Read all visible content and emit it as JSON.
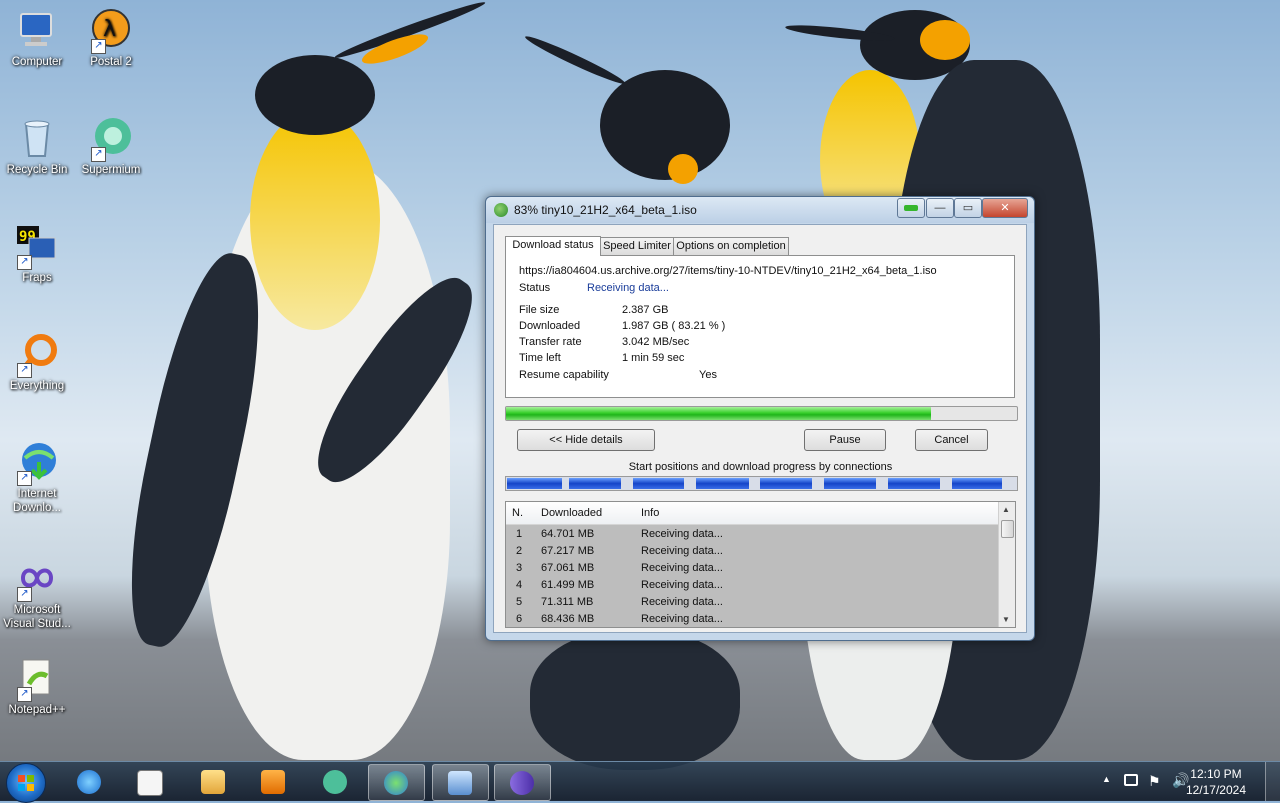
{
  "desktop": {
    "icons": [
      {
        "label": "Computer"
      },
      {
        "label": "Postal 2"
      },
      {
        "label": "Recycle Bin"
      },
      {
        "label": "Supermium"
      },
      {
        "label": "Fraps"
      },
      {
        "label": "Everything"
      },
      {
        "label": "Internet Downlo..."
      },
      {
        "label": "Microsoft Visual Stud..."
      },
      {
        "label": "Notepad++"
      }
    ]
  },
  "window": {
    "title": "83% tiny10_21H2_x64_beta_1.iso",
    "controls": {
      "minimize": "—",
      "restore": "▭",
      "close": "✕"
    },
    "tabs": [
      {
        "label": "Download status",
        "active": true
      },
      {
        "label": "Speed Limiter"
      },
      {
        "label": "Options on completion"
      }
    ],
    "status": {
      "url": "https://ia804604.us.archive.org/27/items/tiny-10-NTDEV/tiny10_21H2_x64_beta_1.iso",
      "status_label": "Status",
      "status_value": "Receiving data...",
      "file_size_label": "File size",
      "file_size_value": "2.387  GB",
      "downloaded_label": "Downloaded",
      "downloaded_value": "1.987  GB  ( 83.21 % )",
      "transfer_rate_label": "Transfer rate",
      "transfer_rate_value": "3.042  MB/sec",
      "time_left_label": "Time left",
      "time_left_value": "1 min 59 sec",
      "resume_label": "Resume capability",
      "resume_value": "Yes"
    },
    "progress_percent": 83.21,
    "buttons": {
      "hide_details": "<< Hide details",
      "pause": "Pause",
      "cancel": "Cancel"
    },
    "connections_caption": "Start positions and download progress by connections",
    "connections_table": {
      "headers": [
        "N.",
        "Downloaded",
        "Info"
      ],
      "rows": [
        [
          "1",
          "64.701  MB",
          "Receiving data..."
        ],
        [
          "2",
          "67.217  MB",
          "Receiving data..."
        ],
        [
          "3",
          "67.061  MB",
          "Receiving data..."
        ],
        [
          "4",
          "61.499  MB",
          "Receiving data..."
        ],
        [
          "5",
          "71.311  MB",
          "Receiving data..."
        ],
        [
          "6",
          "68.436  MB",
          "Receiving data..."
        ]
      ]
    }
  },
  "taskbar": {
    "clock_time": "12:10 PM",
    "clock_date": "12/17/2024",
    "tray_arrow": "▲",
    "pinned": [
      "windows-explorer-ie",
      "notepad",
      "file-explorer",
      "media-player",
      "supermium",
      "internet-download-manager",
      "control-panel",
      "visual-studio"
    ]
  },
  "colors": {
    "accent": "#1f5fbf",
    "progress": "#2fc628",
    "status_text": "#1a3d9a"
  }
}
